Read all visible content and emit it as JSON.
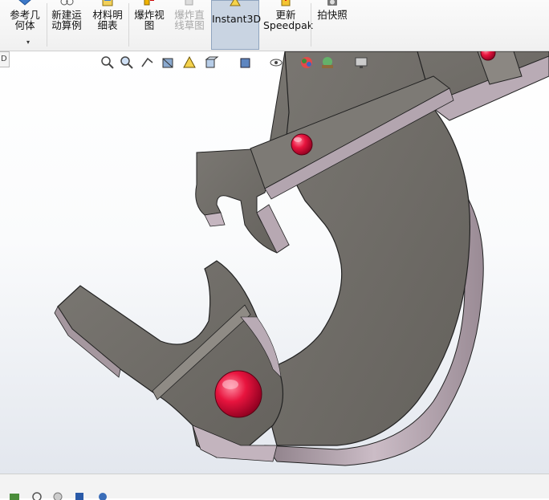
{
  "toolbar": {
    "buttons": [
      {
        "label": "参考几\n何体",
        "icon": "reference-geometry-icon",
        "state": "normal"
      },
      {
        "label": "新建运\n动算例",
        "icon": "motion-study-icon",
        "state": "normal"
      },
      {
        "label": "材料明\n细表",
        "icon": "bill-of-materials-icon",
        "state": "normal"
      },
      {
        "label": "爆炸视\n图",
        "icon": "exploded-view-icon",
        "state": "normal"
      },
      {
        "label": "爆炸直\n线草图",
        "icon": "explode-line-sketch-icon",
        "state": "disabled"
      },
      {
        "label": "Instant3D",
        "icon": "instant3d-icon",
        "state": "active"
      },
      {
        "label": "更新\nSpeedpak",
        "icon": "update-speedpak-icon",
        "state": "normal"
      },
      {
        "label": "拍快照",
        "icon": "snapshot-icon",
        "state": "normal"
      }
    ],
    "dropdown_arrow": "▾"
  },
  "left_tab": {
    "label": "D"
  },
  "view_toolbar": {
    "icons": [
      "zoom-to-fit-icon",
      "zoom-to-area-icon",
      "previous-view-icon",
      "section-view-icon",
      "dynamic-annotation-icon",
      "view-orientation-icon",
      "display-style-icon",
      "hide-show-items-icon",
      "edit-appearance-icon",
      "apply-scene-icon",
      "view-settings-icon"
    ]
  },
  "bottom_bar": {
    "icons": [
      "move-component-icon",
      "rotate-icon",
      "mate-icon",
      "insert-component-icon",
      "appearance-icon"
    ]
  },
  "colors": {
    "part_face": "#6f6c67",
    "part_edge_side": "#a89aa4",
    "pin": "#e0143c",
    "active_button_bg": "#c9d4e2"
  }
}
